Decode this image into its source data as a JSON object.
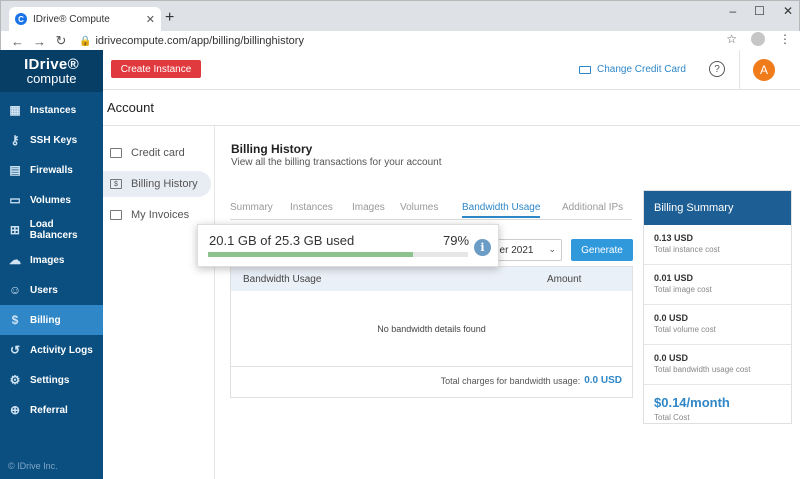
{
  "browser": {
    "tab_title": "IDrive® Compute",
    "url": "idrivecompute.com/app/billing/billinghistory",
    "window_controls": [
      "–",
      "☐",
      "✕"
    ]
  },
  "logo": {
    "top": "IDrive®",
    "bottom": "compute"
  },
  "sidebar": {
    "items": [
      {
        "label": "Instances",
        "icon": "instances-icon"
      },
      {
        "label": "SSH Keys",
        "icon": "key-icon"
      },
      {
        "label": "Firewalls",
        "icon": "firewall-icon"
      },
      {
        "label": "Volumes",
        "icon": "volume-icon"
      },
      {
        "label": "Load Balancers",
        "icon": "load-balancer-icon"
      },
      {
        "label": "Images",
        "icon": "cloud-icon"
      },
      {
        "label": "Users",
        "icon": "user-icon"
      },
      {
        "label": "Billing",
        "icon": "billing-icon",
        "active": true
      },
      {
        "label": "Activity Logs",
        "icon": "history-icon"
      },
      {
        "label": "Settings",
        "icon": "gear-icon"
      },
      {
        "label": "Referral",
        "icon": "referral-icon"
      }
    ],
    "copyright": "© IDrive Inc."
  },
  "header": {
    "create_label": "Create Instance",
    "change_cc_label": "Change Credit Card",
    "help": "?",
    "avatar": "A"
  },
  "account": {
    "title": "Account"
  },
  "subnav": {
    "items": [
      {
        "label": "Credit card"
      },
      {
        "label": "Billing History",
        "active": true
      },
      {
        "label": "My Invoices"
      }
    ]
  },
  "billing": {
    "title": "Billing History",
    "subtitle": "View all the billing transactions for your account",
    "tabs": [
      "Summary",
      "Instances",
      "Images",
      "Volumes",
      "Bandwidth Usage",
      "Additional IPs"
    ],
    "active_tab": "Bandwidth Usage",
    "select_value": "ber 2021",
    "generate_label": "Generate",
    "table": {
      "col1": "Bandwidth Usage",
      "col2": "Amount",
      "empty": "No bandwidth details found",
      "total_label": "Total charges for bandwidth usage:",
      "total_value": "0.0 USD"
    }
  },
  "summary": {
    "title": "Billing Summary",
    "rows": [
      {
        "value": "0.13 USD",
        "label": "Total instance cost"
      },
      {
        "value": "0.01 USD",
        "label": "Total image cost"
      },
      {
        "value": "0.0 USD",
        "label": "Total volume cost"
      },
      {
        "value": "0.0 USD",
        "label": "Total bandwidth usage cost"
      }
    ],
    "total_value": "$0.14/month",
    "total_label": "Total Cost"
  },
  "popup": {
    "text": "20.1 GB of 25.3 GB used",
    "percent_label": "79%",
    "percent": 79,
    "info": "i"
  },
  "colors": {
    "sidebar": "#0b4f80",
    "accent": "#2f87c8",
    "create": "#e03a3e",
    "avatar": "#f07b1a",
    "progress": "#8cc28c"
  }
}
